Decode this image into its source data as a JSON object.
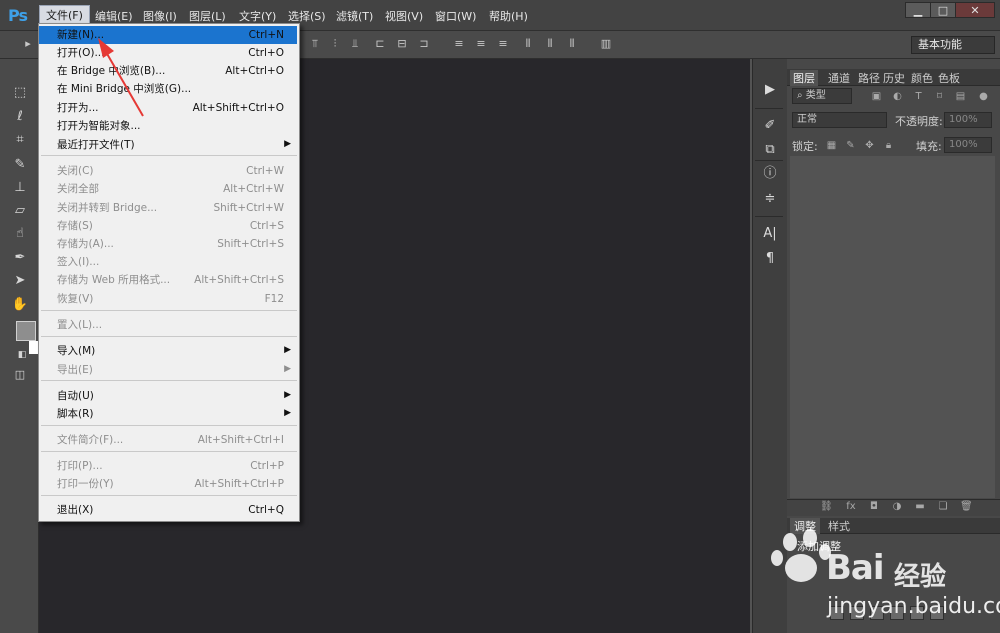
{
  "app": {
    "logo": "Ps"
  },
  "menubar": {
    "items": [
      "文件(F)",
      "编辑(E)",
      "图像(I)",
      "图层(L)",
      "文字(Y)",
      "选择(S)",
      "滤镜(T)",
      "视图(V)",
      "窗口(W)",
      "帮助(H)"
    ],
    "active_index": 0,
    "window_buttons": {
      "minimize": "▁",
      "maximize": "□",
      "close": "✕"
    }
  },
  "optionsbar": {
    "workspace": "基本功能"
  },
  "file_menu": {
    "items": [
      {
        "label": "新建(N)...",
        "shortcut": "Ctrl+N",
        "enabled": true,
        "highlight": true
      },
      {
        "label": "打开(O)...",
        "shortcut": "Ctrl+O",
        "enabled": true
      },
      {
        "label": "在 Bridge 中浏览(B)...",
        "shortcut": "Alt+Ctrl+O",
        "enabled": true
      },
      {
        "label": "在 Mini Bridge 中浏览(G)...",
        "shortcut": "",
        "enabled": true
      },
      {
        "label": "打开为...",
        "shortcut": "Alt+Shift+Ctrl+O",
        "enabled": true
      },
      {
        "label": "打开为智能对象...",
        "shortcut": "",
        "enabled": true
      },
      {
        "label": "最近打开文件(T)",
        "shortcut": "",
        "enabled": true,
        "submenu": true
      },
      {
        "label": "关闭(C)",
        "shortcut": "Ctrl+W",
        "enabled": false
      },
      {
        "label": "关闭全部",
        "shortcut": "Alt+Ctrl+W",
        "enabled": false
      },
      {
        "label": "关闭并转到 Bridge...",
        "shortcut": "Shift+Ctrl+W",
        "enabled": false
      },
      {
        "label": "存储(S)",
        "shortcut": "Ctrl+S",
        "enabled": false
      },
      {
        "label": "存储为(A)...",
        "shortcut": "Shift+Ctrl+S",
        "enabled": false
      },
      {
        "label": "签入(I)...",
        "shortcut": "",
        "enabled": false
      },
      {
        "label": "存储为 Web 所用格式...",
        "shortcut": "Alt+Shift+Ctrl+S",
        "enabled": false
      },
      {
        "label": "恢复(V)",
        "shortcut": "F12",
        "enabled": false
      },
      {
        "label": "置入(L)...",
        "shortcut": "",
        "enabled": false
      },
      {
        "label": "导入(M)",
        "shortcut": "",
        "enabled": true,
        "submenu": true
      },
      {
        "label": "导出(E)",
        "shortcut": "",
        "enabled": false,
        "submenu": true
      },
      {
        "label": "自动(U)",
        "shortcut": "",
        "enabled": true,
        "submenu": true
      },
      {
        "label": "脚本(R)",
        "shortcut": "",
        "enabled": true,
        "submenu": true
      },
      {
        "label": "文件简介(F)...",
        "shortcut": "Alt+Shift+Ctrl+I",
        "enabled": false
      },
      {
        "label": "打印(P)...",
        "shortcut": "Ctrl+P",
        "enabled": false
      },
      {
        "label": "打印一份(Y)",
        "shortcut": "Alt+Shift+Ctrl+P",
        "enabled": false
      },
      {
        "label": "退出(X)",
        "shortcut": "Ctrl+Q",
        "enabled": true
      }
    ],
    "submenu_arrow": "▶"
  },
  "layers_panel": {
    "tabs": [
      "图层",
      "通道",
      "路径",
      "历史",
      "颜色",
      "色板"
    ],
    "kind_filter": "类型",
    "blend_mode": "正常",
    "opacity_label": "不透明度:",
    "opacity_value": "100%",
    "lock_label": "锁定:",
    "fill_label": "填充:",
    "fill_value": "100%"
  },
  "adjustments_panel": {
    "tabs": [
      "调整",
      "样式"
    ],
    "title": "添加调整"
  },
  "watermark": {
    "brand1": "Bai",
    "brand2": "经验",
    "url": "jingyan.baidu.com"
  },
  "colors": {
    "highlight": "#1b74cf",
    "annotation_arrow": "#e53935",
    "ps_blue": "#3ea0e8"
  }
}
